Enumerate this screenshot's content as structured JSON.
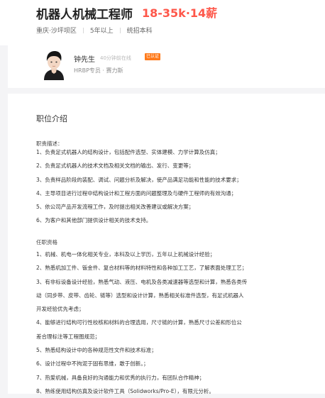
{
  "job": {
    "title": "机器人机械工程师",
    "salary": "18-35k·14薪",
    "location": "重庆·沙坪坝区",
    "experience": "5年以上",
    "education": "统招本科"
  },
  "recruiter": {
    "name": "钟先生",
    "status": "40分钟前在线",
    "badge": "已认证",
    "role": "HRBP专员 · 赛力斯"
  },
  "description": {
    "heading": "职位介绍",
    "duties_title": "职责描述：",
    "duties": [
      "1、负责足式机器人的结构设计，包括配件选型、实体建模、力学计算及仿真；",
      "2、负责足式机器人的技术文档及相关文档的输出、发行、变更等；",
      "3、负责样品阶段的装配、调试、问题分析及解决，使产品满足功能和性能的技术要求；",
      "4、主导项目进行过程中结构设计和工程方面的问题整理及与硬件工程师的有效沟通；",
      "5、依公司产品开发流程工作，及时提出相关改善建议或解决方案；",
      "6、为客户和其他部门提供设计相关的技术支持。"
    ],
    "requirements_title": "任职资格",
    "requirements": [
      "1、机械、机电一体化相关专业，本科及以上学历，五年以上机械设计经验；",
      "2、熟悉机加工件、钣金件、复合材料等的材料特性和各种加工工艺，了解表面处理工艺；",
      "3、有非标设备设计经验，熟悉气动、液压、电机及各类减速器等选型和计算，熟悉各类传",
      "动（同步带、皮带、齿轮、链等）选型和设计计算，熟悉相关标准件选型，有足式机器人",
      "开发经验优先考虑；",
      "4、能够进行结构可行性校核和材料的合理选用，尺寸链的计算，熟悉尺寸公差和形位公",
      "差合理标注等工程图规范；",
      "5、熟悉结构设计中的各种规范性文件和技术标准；",
      "6、设计过程中不拘泥于固有思维，敢于创新。；",
      "7、热爱机械，具备良好的沟通能力和优秀的执行力，有团队合作精神；",
      "8、熟练使用结构仿真及设计软件工具（Solidworks/Pro-E），有限元分析。"
    ]
  }
}
